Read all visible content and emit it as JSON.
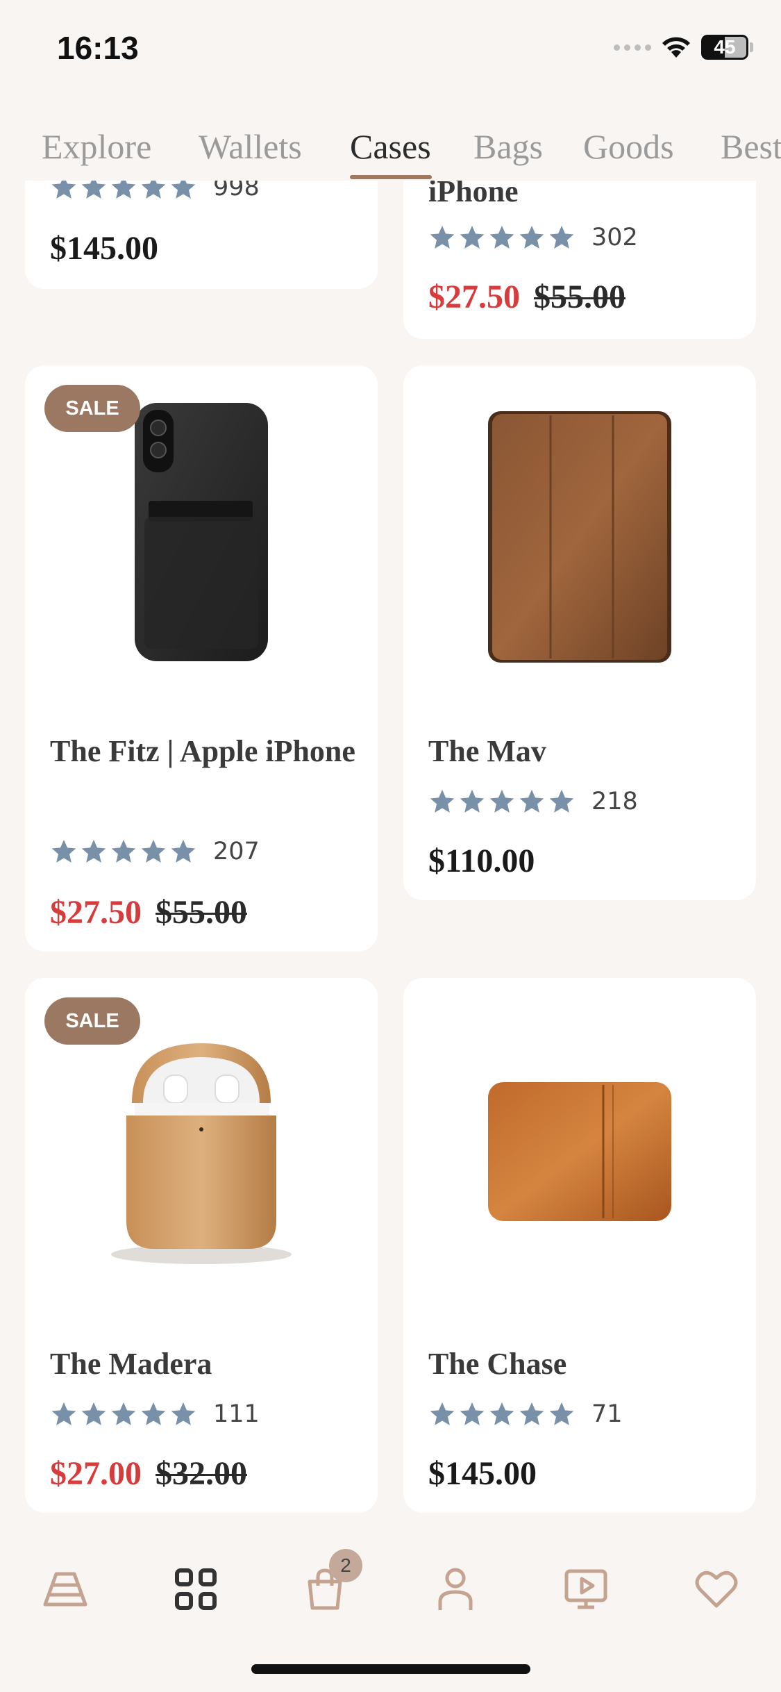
{
  "status": {
    "time": "16:13",
    "battery": "45"
  },
  "tabs": [
    {
      "label": "Explore"
    },
    {
      "label": "Wallets"
    },
    {
      "label": "Cases"
    },
    {
      "label": "Bags"
    },
    {
      "label": "Goods"
    },
    {
      "label": "Best"
    }
  ],
  "active_tab": "Cases",
  "colors": {
    "accent": "#a0785f",
    "sale_red": "#d63c3c",
    "star": "#7890a8",
    "badge": "#9b7862"
  },
  "products": [
    {
      "name": "",
      "rating": 5,
      "reviews": "998",
      "price": "$145.00"
    },
    {
      "name": "iPhone",
      "rating": 5,
      "reviews": "302",
      "sale_price": "$27.50",
      "old_price": "$55.00"
    },
    {
      "badge": "SALE",
      "name": "The Fitz | Apple iPhone",
      "rating": 5,
      "reviews": "207",
      "sale_price": "$27.50",
      "old_price": "$55.00",
      "image": "black-leather-phone-case"
    },
    {
      "name": "The Mav",
      "rating": 5,
      "reviews": "218",
      "price": "$110.00",
      "image": "brown-leather-tablet-case"
    },
    {
      "badge": "SALE",
      "name": "The Madera",
      "rating": 5,
      "reviews": "111",
      "sale_price": "$27.00",
      "old_price": "$32.00",
      "image": "wooden-airpods-case"
    },
    {
      "name": "The Chase",
      "rating": 5,
      "reviews": "71",
      "price": "$145.00",
      "image": "tan-leather-laptop-sleeve"
    }
  ],
  "bottom_nav": [
    {
      "icon": "home-icon"
    },
    {
      "icon": "grid-icon"
    },
    {
      "icon": "shopping-bag-icon",
      "badge": "2"
    },
    {
      "icon": "profile-icon"
    },
    {
      "icon": "video-icon"
    },
    {
      "icon": "heart-icon"
    }
  ]
}
